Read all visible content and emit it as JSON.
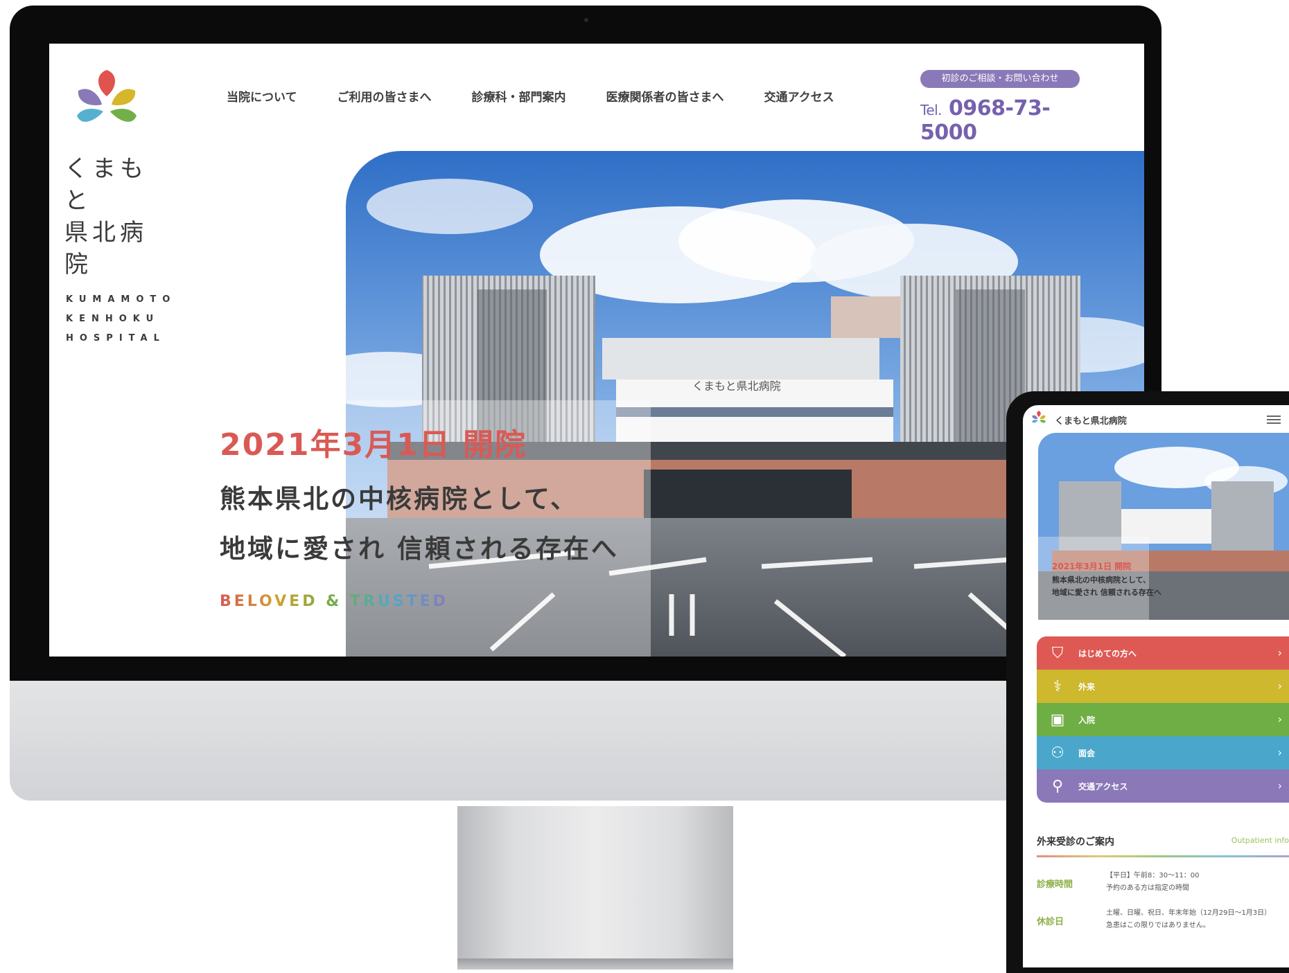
{
  "desktop": {
    "logo": {
      "name_jp_line1": "くまもと",
      "name_jp_line2": "県北病院",
      "name_en_line1": "KUMAMOTO",
      "name_en_line2": "KENHOKU",
      "name_en_line3": "HOSPITAL"
    },
    "nav": [
      {
        "label": "当院について"
      },
      {
        "label": "ご利用の皆さまへ"
      },
      {
        "label": "診療科・部門案内"
      },
      {
        "label": "医療関係者の皆さまへ"
      },
      {
        "label": "交通アクセス"
      }
    ],
    "contact": {
      "badge": "初診のご相談・お問い合わせ",
      "tel_prefix": "Tel.",
      "tel_number": "0968-73-5000"
    },
    "hero": {
      "date": "2021年3月1日 開院",
      "line1": "熊本県北の中核病院として、",
      "line2": "地域に愛され 信頼される存在へ",
      "tagline": "BELOVED & TRUSTED",
      "building_sign": "くまもと県北病院"
    }
  },
  "mobile": {
    "header_title": "くまもと県北病院",
    "hero": {
      "date": "2021年3月1日 開院",
      "line1": "熊本県北の中核病院として、",
      "line2": "地域に愛され 信頼される存在へ"
    },
    "cards": [
      {
        "label": "はじめての方へ",
        "color": "#df5954",
        "icon": "shield-icon"
      },
      {
        "label": "外来",
        "color": "#cdb82e",
        "icon": "stethoscope-icon"
      },
      {
        "label": "入院",
        "color": "#6fae44",
        "icon": "bed-icon"
      },
      {
        "label": "面会",
        "color": "#4aa7cb",
        "icon": "people-icon"
      },
      {
        "label": "交通アクセス",
        "color": "#8a78b8",
        "icon": "access-icon"
      }
    ],
    "section": {
      "title": "外来受診のご案内",
      "title_en": "Outpatient info",
      "rows": [
        {
          "key": "診療時間",
          "value1": "【平日】午前8：30～11：00",
          "value2": "予約のある方は指定の時間"
        },
        {
          "key": "休診日",
          "value1": "土曜、日曜、祝日、年末年始（12月29日～1月3日）",
          "value2": "急患はこの限りではありません。"
        }
      ]
    }
  },
  "colors": {
    "accent_red": "#d95a55",
    "accent_purple": "#8a79b8",
    "tel_purple": "#7561ad"
  }
}
